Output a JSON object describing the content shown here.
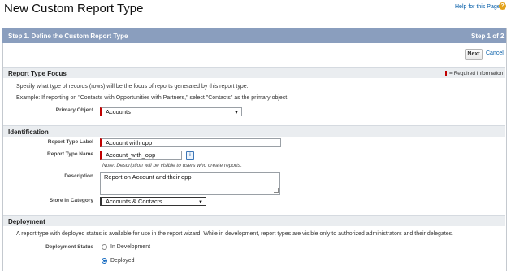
{
  "page": {
    "title": "New Custom Report Type",
    "help_link": "Help for this Page",
    "help_icon": "question-icon"
  },
  "step": {
    "title": "Step 1. Define the Custom Report Type",
    "count": "Step 1 of 2"
  },
  "actions": {
    "next_label": "Next",
    "cancel_label": "Cancel"
  },
  "focus_section": {
    "title": "Report Type Focus",
    "required_legend": "= Required Information",
    "description": "Specify what type of records (rows) will be the focus of reports generated by this report type.",
    "example": "Example: If reporting on \"Contacts with Opportunities with Partners,\" select \"Contacts\" as the primary object.",
    "primary_object_label": "Primary Object",
    "primary_object_value": "Accounts"
  },
  "identification": {
    "title": "Identification",
    "label_label": "Report Type Label",
    "label_value": "Account with opp",
    "name_label": "Report Type Name",
    "name_value": "Account_with_opp",
    "note": "Note: Description will be visible to users who create reports.",
    "description_label": "Description",
    "description_value": "Report on Account and their opp",
    "category_label": "Store in Category",
    "category_value": "Accounts & Contacts"
  },
  "deployment": {
    "title": "Deployment",
    "description": "A report type with deployed status is available for use in the report wizard. While in development, report types are visible only to authorized administrators and their delegates.",
    "status_label": "Deployment Status",
    "options": [
      "In Development",
      "Deployed"
    ],
    "selected": "Deployed"
  },
  "colors": {
    "step_bar": "#8a9ebe",
    "required": "#c00000",
    "link": "#015ba7"
  }
}
